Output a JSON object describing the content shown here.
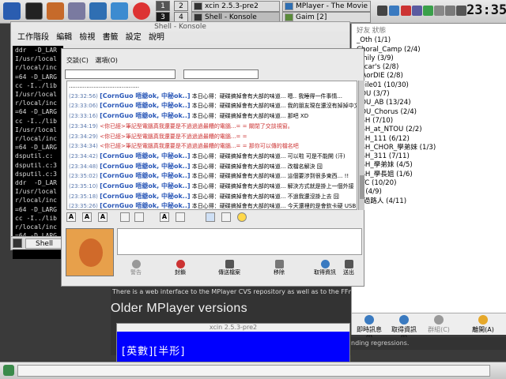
{
  "topbar": {
    "pager": [
      "1",
      "2",
      "3",
      "4"
    ],
    "tasks": [
      "xcin 2.5.3-pre2",
      "MPlayer - The Movie Pla",
      "Shell - Konsole",
      "Gaim [2]"
    ],
    "clock": "23:35",
    "launcher_icons": [
      "kde-menu-icon",
      "konsole-icon",
      "home-icon",
      "tools-icon",
      "browser-icon",
      "settings-icon",
      "help-icon"
    ]
  },
  "konsole": {
    "title": "Shell - Konsole",
    "menu": [
      "工作階段",
      "編輯",
      "檢視",
      "書籤",
      "設定",
      "說明"
    ],
    "lines": [
      "ddr  -D_LAR",
      "I/usr/local",
      "r/local/inc",
      "=64 -D_LARG",
      "cc -I../lib",
      "I/usr/local",
      "r/local/inc",
      "=64 -D_LARG",
      "cc -I../lib",
      "I/usr/local",
      "r/local/inc",
      "=64 -D_LARG",
      "dsputil.c:",
      "dsputil.c:3",
      "dsputil.c:3",
      "ddr  -D_LAR",
      "I/usr/local",
      "r/local/inc",
      "=64 -D_LARG",
      "cc -I../lib",
      "r/local/inc",
      "=64 -D_LARG"
    ],
    "tab": "Shell"
  },
  "gaim": {
    "header": "好友  狀態",
    "buddies": [
      "_Oth (1/1)",
      "Choral_Camp (2/4)",
      "amily (3/9)",
      "oscar's (2/8)",
      "DAorDIE (2/8)",
      "obile01 (10/30)",
      "TOU (3/7)",
      "TOU_AB (13/24)",
      "TOU_Chorus (2/4)",
      "SSH (7/10)",
      "SSH_at_NTOU (2/2)",
      "SSH_111 (6/12)",
      "SSH_CHOR_學弟妹 (1/3)",
      "SSH_311 (7/11)",
      "SSH_學弟妹 (4/5)",
      "SSH_學長姐 (1/6)",
      "SYC (10/20)",
      "友 (4/9)",
      "跑過路人 (4/11)"
    ],
    "actions": [
      "即時訊息(I)",
      "取得資訊(I)",
      "群組(C)",
      "離開(A)"
    ]
  },
  "chat": {
    "menu": [
      "交談(C)",
      "選項(O)"
    ],
    "messages": [
      {
        "time": "",
        "name": "",
        "text": "........................................"
      },
      {
        "time": "(23:32:56)",
        "name": "[CornGuo 唔爺ok, 中秘ok..]",
        "text": "本日心得：硬碟搞掉會有大部的味道... 嗯.. 我睡得一件事情..."
      },
      {
        "time": "(23:33:06)",
        "name": "[CornGuo 唔爺ok, 中秘ok..]",
        "text": "本日心得：硬碟搞掉會有大部的味道... 我的朋友現在還沒有掉掉中文檔名稱 啊"
      },
      {
        "time": "(23:33:16)",
        "name": "[CornGuo 唔爺ok, 中秘ok..]",
        "text": "本日心得：硬碟搞掉會有大部的味道... 那吧 XD"
      },
      {
        "time": "(23:34:19)",
        "name": "",
        "text": "<你已經>筆記型電腦真我還要是不過過過最糟的電腦...= = 關閉了交談視窗。"
      },
      {
        "time": "(23:34:29)",
        "name": "",
        "text": "<你已經>筆記型電腦真我還要是不過過過最糟的電腦...= ="
      },
      {
        "time": "(23:34:34)",
        "name": "",
        "text": "<你已經>筆記型電腦真我還要是不過過過最糟的電腦...= = 那你可以傳的檔名吧"
      },
      {
        "time": "(23:34:42)",
        "name": "[CornGuo 唔爺ok, 中秘ok..]",
        "text": "本日心得：硬碟搞掉會有大部的味道... 可以啦 可是不能開 (汗)"
      },
      {
        "time": "(23:34:48)",
        "name": "[CornGuo 唔爺ok, 中秘ok..]",
        "text": "本日心得：硬碟搞掉會有大部的味道... 改檔名解決 囧"
      },
      {
        "time": "(23:35:02)",
        "name": "[CornGuo 唔爺ok, 中秘ok..]",
        "text": "本日心得：硬碟搞掉會有大部的味道... 這個要涉到很多東西... !!"
      },
      {
        "time": "(23:35:10)",
        "name": "[CornGuo 唔爺ok, 中秘ok..]",
        "text": "本日心得：硬碟搞掉會有大部的味道... 解決方式就是掛上一個外接"
      },
      {
        "time": "(23:35:18)",
        "name": "[CornGuo 唔爺ok, 中秘ok..]",
        "text": "本日心得：硬碟搞掉會有大部的味道... 不過我還沒掛上去  囧"
      },
      {
        "time": "(23:35:26)",
        "name": "[CornGuo 唔爺ok, 中秘ok..]",
        "text": "本日心得：硬碟搞掉會有大部的味道... 今天還裡的是會欽卡硬  USB"
      }
    ],
    "format_labels": [
      "A",
      "A",
      "A",
      "A"
    ],
    "buttons": [
      "警告",
      "封鎖",
      "傳送檔案",
      "移除",
      "取得資訊",
      "送出"
    ]
  },
  "browser": {
    "info": "There is a web interface to the MPlayer CVS repository as well as to the FFmpeg CV",
    "heading": "Older MPlayer versions",
    "regr": "nding regressions."
  },
  "xcin": {
    "title": "xcin 2.5.3-pre2",
    "text": "[英數][半形]"
  },
  "colors": {
    "xcin_bg": "#0000ff",
    "chat_name": "#2957b8",
    "link_orange": "#ff9000"
  }
}
